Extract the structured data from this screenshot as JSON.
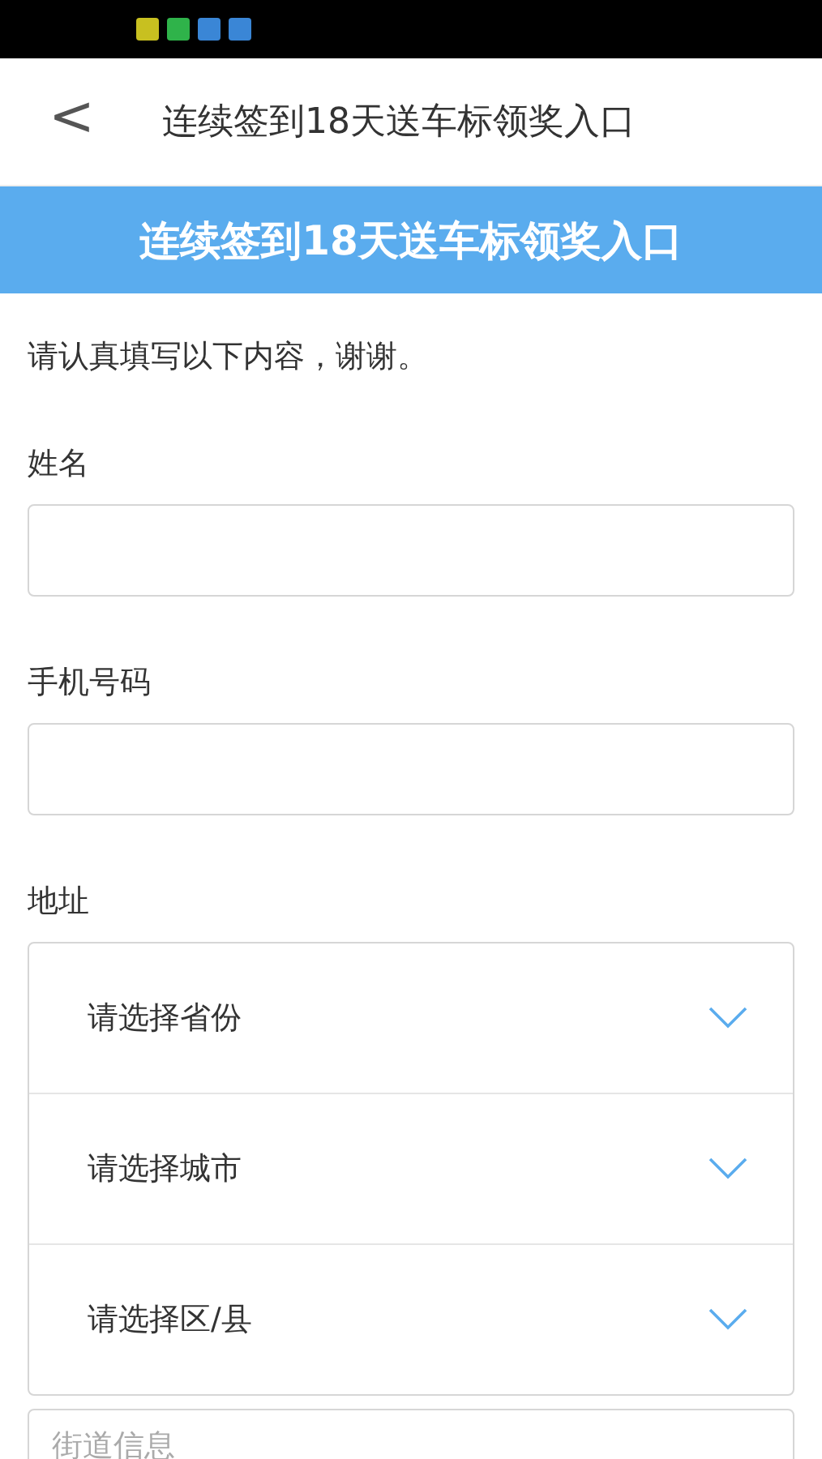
{
  "status_bar": {
    "notifications": [
      {
        "color": "#c8c020"
      },
      {
        "color": "#2fb34a"
      },
      {
        "color": "#3a86d6"
      },
      {
        "color": "#3a86d6"
      }
    ]
  },
  "nav": {
    "back": "<",
    "title": "连续签到18天送车标领奖入口"
  },
  "banner": {
    "title": "连续签到18天送车标领奖入口"
  },
  "form": {
    "intro": "请认真填写以下内容，谢谢。",
    "fields": [
      {
        "label": "姓名"
      },
      {
        "label": "手机号码"
      }
    ],
    "address": {
      "label": "地址",
      "selects": [
        {
          "placeholder": "请选择省份"
        },
        {
          "placeholder": "请选择城市"
        },
        {
          "placeholder": "请选择区/县"
        }
      ],
      "street": {
        "placeholder": "街道信息"
      }
    }
  }
}
